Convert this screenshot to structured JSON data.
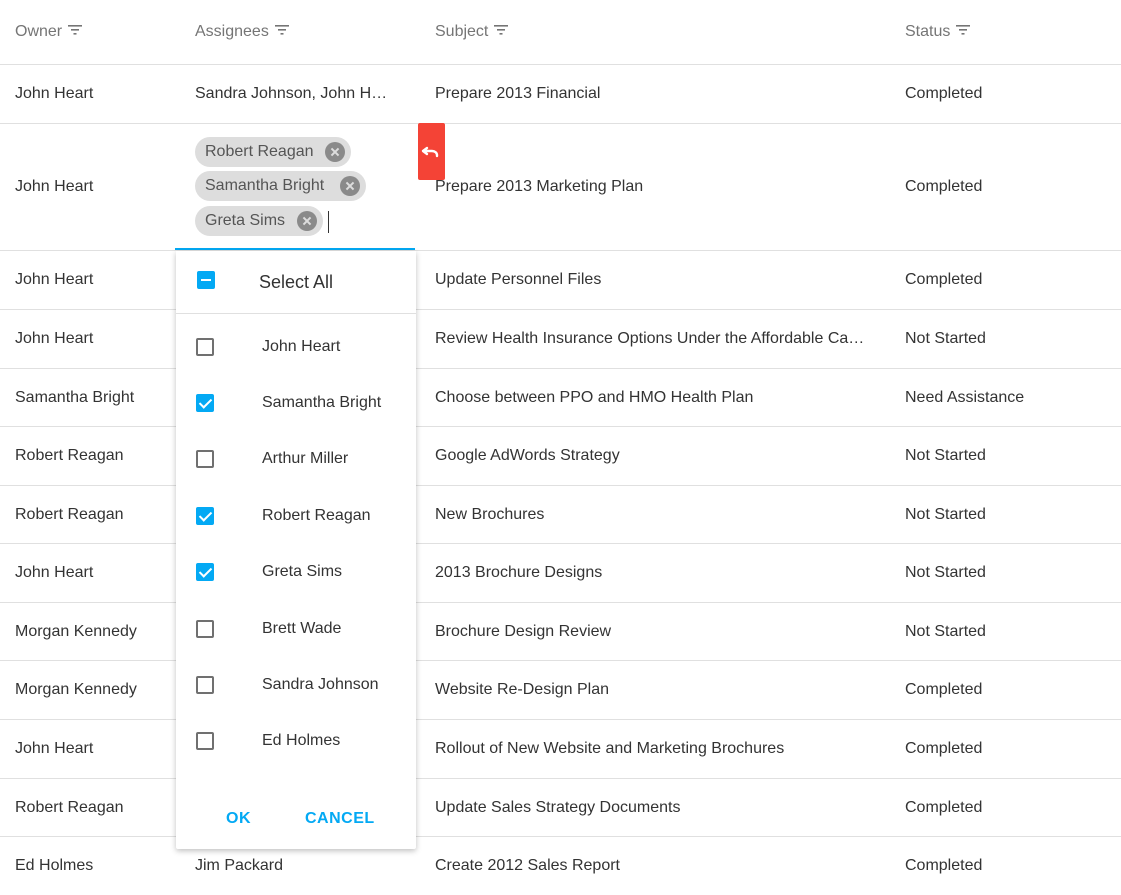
{
  "columns": {
    "owner": "Owner",
    "assignees": "Assignees",
    "subject": "Subject",
    "status": "Status"
  },
  "rows": [
    {
      "owner": "John Heart",
      "assignees": "Sandra Johnson, John Heart",
      "subject": "Prepare 2013 Financial",
      "status": "Completed"
    },
    {
      "owner": "John Heart",
      "assignees": "",
      "subject": "Prepare 2013 Marketing Plan",
      "status": "Completed"
    },
    {
      "owner": "John Heart",
      "assignees": "",
      "subject": "Update Personnel Files",
      "status": "Completed"
    },
    {
      "owner": "John Heart",
      "assignees": "",
      "subject": "Review Health Insurance Options Under the Affordable Care Act",
      "status": "Not Started"
    },
    {
      "owner": "Samantha Bright",
      "assignees": "",
      "subject": "Choose between PPO and HMO Health Plan",
      "status": "Need Assistance"
    },
    {
      "owner": "Robert Reagan",
      "assignees": "",
      "subject": "Google AdWords Strategy",
      "status": "Not Started"
    },
    {
      "owner": "Robert Reagan",
      "assignees": "",
      "subject": "New Brochures",
      "status": "Not Started"
    },
    {
      "owner": "John Heart",
      "assignees": "",
      "subject": "2013 Brochure Designs",
      "status": "Not Started"
    },
    {
      "owner": "Morgan Kennedy",
      "assignees": "",
      "subject": "Brochure Design Review",
      "status": "Not Started"
    },
    {
      "owner": "Morgan Kennedy",
      "assignees": "",
      "subject": "Website Re-Design Plan",
      "status": "Completed"
    },
    {
      "owner": "John Heart",
      "assignees": "",
      "subject": "Rollout of New Website and Marketing Brochures",
      "status": "Completed"
    },
    {
      "owner": "Robert Reagan",
      "assignees": "",
      "subject": "Update Sales Strategy Documents",
      "status": "Completed"
    },
    {
      "owner": "Ed Holmes",
      "assignees": "Jim Packard",
      "subject": "Create 2012 Sales Report",
      "status": "Completed"
    }
  ],
  "editor": {
    "tags": [
      "Robert Reagan",
      "Samantha Bright",
      "Greta Sims"
    ]
  },
  "dropdown": {
    "select_all": "Select All",
    "options": [
      {
        "label": "John Heart",
        "checked": false
      },
      {
        "label": "Samantha Bright",
        "checked": true
      },
      {
        "label": "Arthur Miller",
        "checked": false
      },
      {
        "label": "Robert Reagan",
        "checked": true
      },
      {
        "label": "Greta Sims",
        "checked": true
      },
      {
        "label": "Brett Wade",
        "checked": false
      },
      {
        "label": "Sandra Johnson",
        "checked": false
      },
      {
        "label": "Ed Holmes",
        "checked": false
      }
    ],
    "ok": "OK",
    "cancel": "CANCEL"
  },
  "colors": {
    "accent": "#03a9f4",
    "revert": "#f44336",
    "tag_bg": "#dddddd"
  },
  "icons": {
    "header_filter": "filter-icon",
    "tag_remove": "remove-tag-icon",
    "revert": "undo-icon"
  }
}
